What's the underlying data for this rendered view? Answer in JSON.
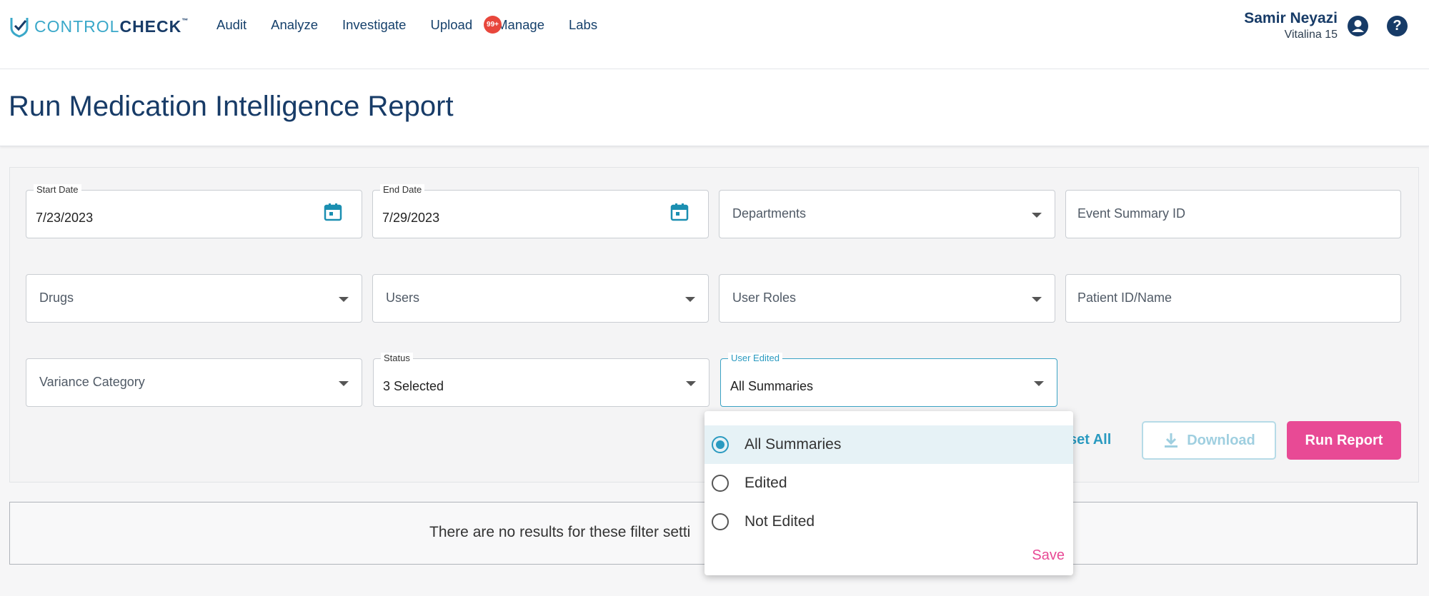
{
  "brand": {
    "part1": "CONTROL",
    "part2": "CHECK",
    "tm": "™"
  },
  "nav": [
    {
      "label": "Audit"
    },
    {
      "label": "Analyze"
    },
    {
      "label": "Investigate"
    },
    {
      "label": "Upload"
    },
    {
      "label": "Manage"
    },
    {
      "label": "Labs"
    }
  ],
  "upload_badge": "99+",
  "user": {
    "name": "Samir Neyazi",
    "subtitle": "Vitalina 15"
  },
  "page_title": "Run Medication Intelligence Report",
  "filters": {
    "start_date": {
      "label": "Start Date",
      "value": "7/23/2023"
    },
    "end_date": {
      "label": "End Date",
      "value": "7/29/2023"
    },
    "departments": {
      "placeholder": "Departments"
    },
    "event_summary_id": {
      "placeholder": "Event Summary ID"
    },
    "drugs": {
      "placeholder": "Drugs"
    },
    "users": {
      "placeholder": "Users"
    },
    "user_roles": {
      "placeholder": "User Roles"
    },
    "patient": {
      "placeholder": "Patient ID/Name"
    },
    "variance_category": {
      "placeholder": "Variance Category"
    },
    "status": {
      "label": "Status",
      "value": "3 Selected"
    },
    "user_edited": {
      "label": "User Edited",
      "value": "All Summaries"
    }
  },
  "actions": {
    "reset": "set All",
    "download": "Download",
    "run": "Run Report"
  },
  "results_message": "There are no results for these filter setti",
  "dropdown": {
    "options": [
      {
        "label": "All Summaries",
        "selected": true
      },
      {
        "label": "Edited",
        "selected": false
      },
      {
        "label": "Not Edited",
        "selected": false
      }
    ],
    "save": "Save"
  },
  "colors": {
    "accent": "#2a9ac0",
    "brand_dark": "#173b67",
    "primary_button": "#e84a95",
    "badge": "#e8473c"
  }
}
